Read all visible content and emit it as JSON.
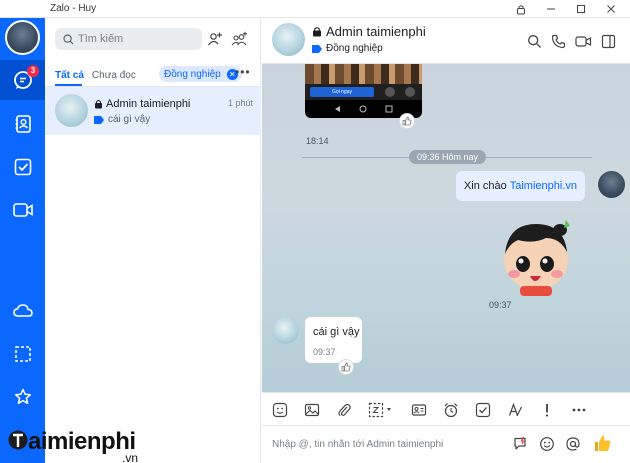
{
  "window": {
    "title": "Zalo - Huy"
  },
  "nav": {
    "messages_badge": "3"
  },
  "list": {
    "search_placeholder": "Tìm kiếm",
    "tabs": [
      {
        "label": "Tất cả"
      },
      {
        "label": "Chưa đọc"
      }
    ],
    "filter_label": "Đồng nghiệp",
    "more_label": "•••",
    "conversations": [
      {
        "name": "Admin taimienphi",
        "time": "1 phút",
        "preview": "cái gì vậy"
      }
    ]
  },
  "chat": {
    "name": "Admin taimienphi",
    "tag": "Đồng nghiệp",
    "messages": {
      "image_time": "18:14",
      "image_button_text": "Gọi ngay",
      "date_separator": "09:36 Hôm nay",
      "outgoing_prefix": "Xin chào",
      "outgoing_link": "Taimienphi.vn",
      "sticker_time": "09:37",
      "incoming_text": "cái gì vậy",
      "incoming_time": "09:37"
    }
  },
  "composer": {
    "placeholder": "Nhập @, tin nhắn tới Admin taimienphi"
  },
  "watermark": {
    "brand": "aimienphi",
    "suffix": ".vn"
  },
  "colors": {
    "primary": "#0a68ff",
    "nav_bg": "#0a68ff",
    "badge": "#f0284a"
  }
}
